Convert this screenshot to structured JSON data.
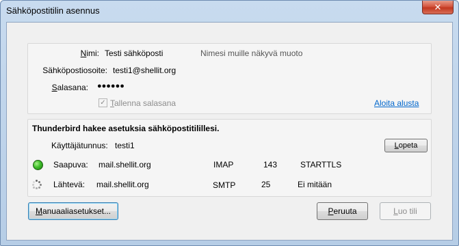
{
  "window": {
    "title": "Sähköpostitilin asennus",
    "close_glyph": "✕"
  },
  "account": {
    "name_label_u": "N",
    "name_label_rest": "imi:",
    "name_value": "Testi sähköposti",
    "name_hint": "Nimesi muille näkyvä muoto",
    "email_label": "Sähköpostiosoite:",
    "email_value": "testi1@shellit.org",
    "password_label_u": "S",
    "password_label_rest": "alasana:",
    "password_value": "●●●●●●",
    "remember_u": "T",
    "remember_rest": "allenna salasana",
    "restart_link": "Aloita alusta"
  },
  "status": {
    "heading": "Thunderbird hakee asetuksia sähköpostitilillesi.",
    "username_label": "Käyttäjätunnus:",
    "username_value": "testi1",
    "stop_button_u": "L",
    "stop_button_rest": "opeta",
    "incoming": {
      "label": "Saapuva:",
      "server": "mail.shellit.org",
      "protocol": "IMAP",
      "port": "143",
      "security": "STARTTLS",
      "status_color": "#3fbf2a"
    },
    "outgoing": {
      "label": "Lähtevä:",
      "server": "mail.shellit.org",
      "protocol": "SMTP",
      "port": "25",
      "security": "Ei mitään"
    }
  },
  "footer": {
    "manual_u": "M",
    "manual_rest": "anuaaliasetukset...",
    "cancel_u": "P",
    "cancel_rest": "eruuta",
    "create_u": "L",
    "create_rest": "uo tili"
  }
}
